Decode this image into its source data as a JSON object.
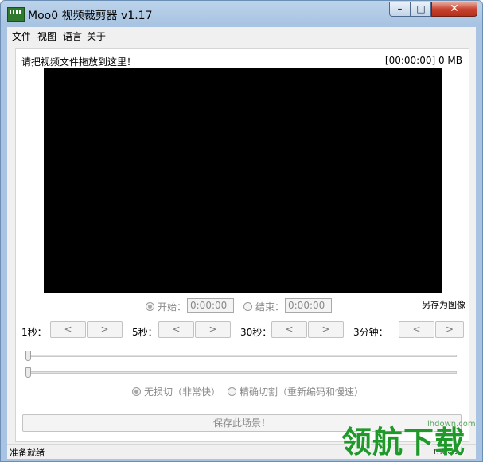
{
  "window": {
    "title": "Moo0 视频裁剪器 v1.17",
    "min_symbol": "–",
    "max_symbol": "□",
    "close_symbol": "✕"
  },
  "menu": {
    "items": [
      "文件",
      "视图",
      "语言",
      "关于"
    ]
  },
  "main": {
    "drop_hint": "请把视频文件拖放到这里！",
    "time_info": "[00:00:00]  0 MB"
  },
  "range": {
    "start_label": "开始：",
    "start_value": "0:00:00",
    "end_label": "结束：",
    "end_value": "0:00:00",
    "save_image_link": "另存为图像"
  },
  "steps": [
    {
      "label": "1秒：",
      "prev": "<",
      "next": ">"
    },
    {
      "label": "5秒：",
      "prev": "<",
      "next": ">"
    },
    {
      "label": "30秒：",
      "prev": "<",
      "next": ">"
    },
    {
      "label": "3分钟：",
      "prev": "<",
      "next": ">"
    }
  ],
  "modes": {
    "lossless": "无损切（非常快）",
    "precise": "精确切割（重新编码和慢速）",
    "selected": "lossless"
  },
  "save_button": "保存此场景！",
  "status": {
    "text": "准备就绪",
    "right": "moo0"
  },
  "watermark": {
    "text": "领航下载",
    "url": "lhdown.com"
  }
}
